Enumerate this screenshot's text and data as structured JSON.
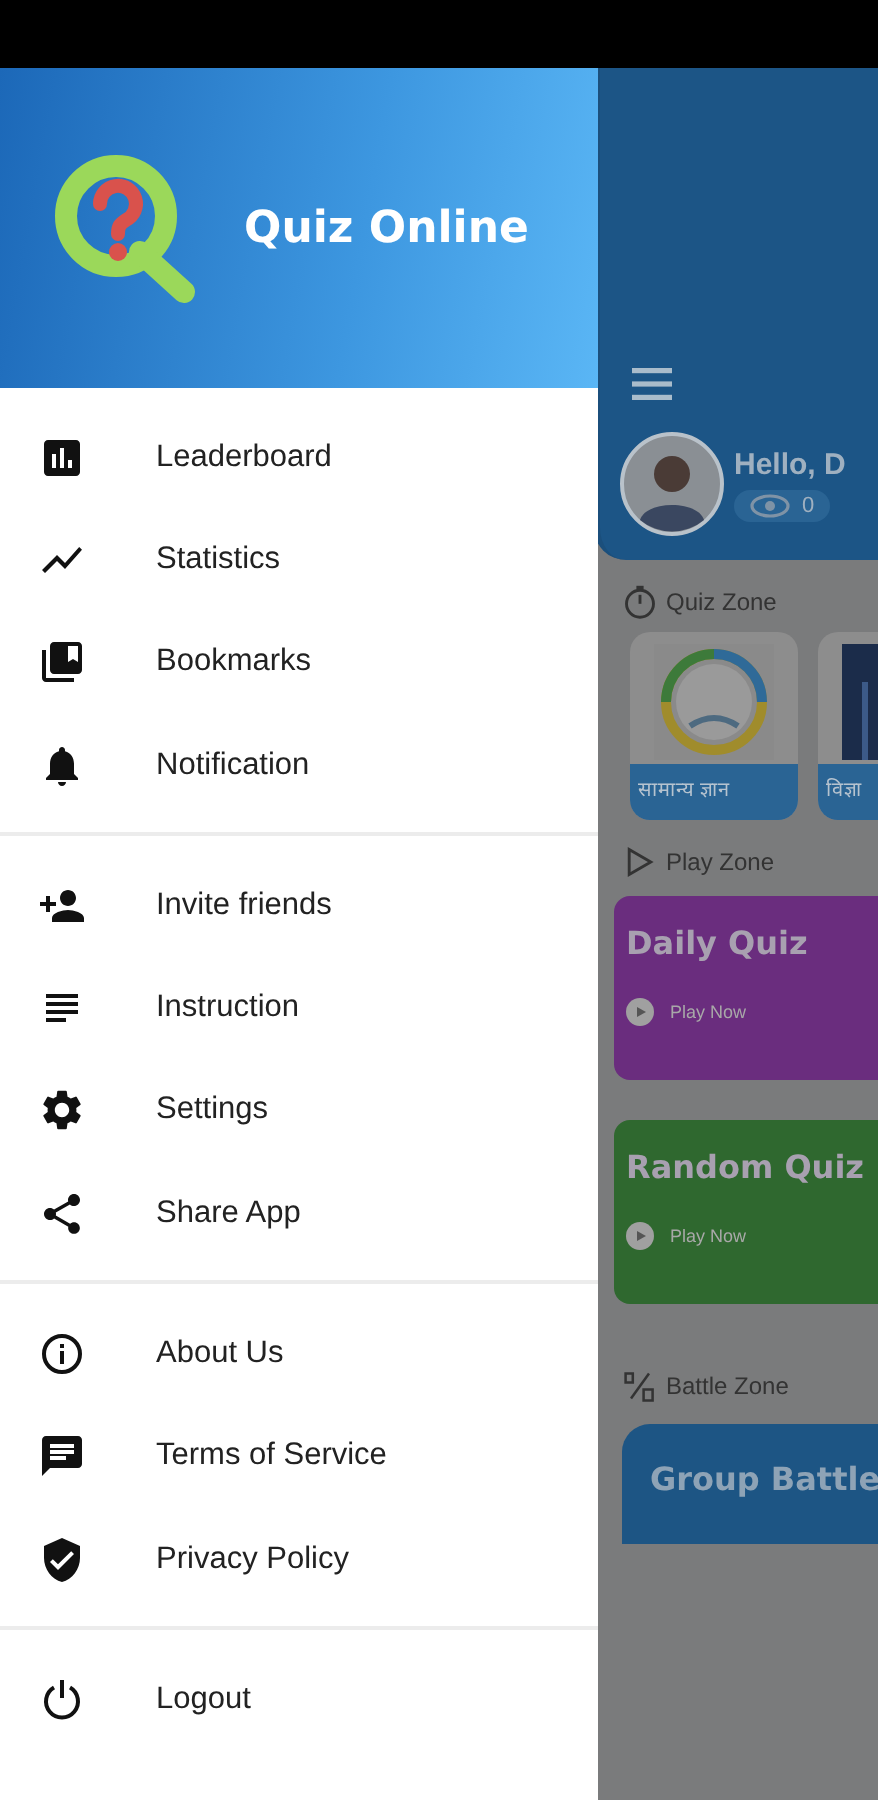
{
  "drawer": {
    "header": {
      "title": "Quiz Online"
    },
    "groups": [
      {
        "items": [
          {
            "label": "Leaderboard",
            "kind": "leaderboard"
          },
          {
            "label": "Statistics",
            "kind": "statistics"
          },
          {
            "label": "Bookmarks",
            "kind": "bookmarks"
          },
          {
            "label": "Notification",
            "kind": "notification"
          }
        ]
      },
      {
        "items": [
          {
            "label": "Invite friends",
            "kind": "invite"
          },
          {
            "label": "Instruction",
            "kind": "instruction"
          },
          {
            "label": "Settings",
            "kind": "settings"
          },
          {
            "label": "Share App",
            "kind": "share"
          }
        ]
      },
      {
        "items": [
          {
            "label": "About Us",
            "kind": "about"
          },
          {
            "label": "Terms of Service",
            "kind": "terms"
          },
          {
            "label": "Privacy Policy",
            "kind": "privacy"
          }
        ]
      },
      {
        "items": [
          {
            "label": "Logout",
            "kind": "logout"
          }
        ]
      }
    ]
  },
  "home": {
    "greeting": "Hello, D",
    "coins": "0",
    "quiz_zone": {
      "title": "Quiz Zone",
      "cards": [
        {
          "title": "सामान्य ज्ञान"
        },
        {
          "title": "विज्ञा"
        }
      ]
    },
    "play_zone": {
      "title": "Play Zone",
      "cards": [
        {
          "title": "Daily Quiz",
          "action": "Play Now",
          "color": "#6a2d7e"
        },
        {
          "title": "Random Quiz",
          "action": "Play Now",
          "color": "#2f682f"
        }
      ]
    },
    "battle_zone": {
      "title": "Battle Zone",
      "cards": [
        {
          "title": "Group Battle"
        }
      ]
    }
  }
}
